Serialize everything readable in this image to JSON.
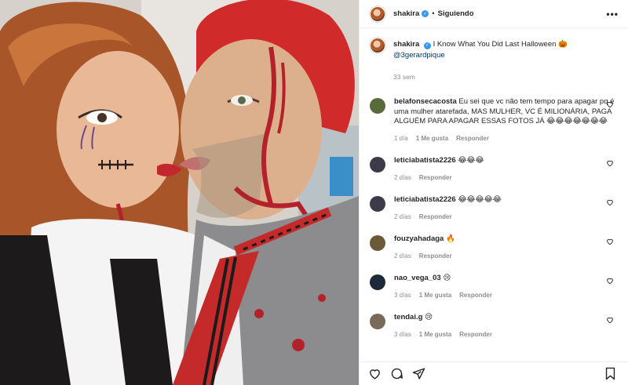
{
  "header": {
    "username": "shakira",
    "separator": "•",
    "follow_state": "Siguiendo",
    "more_icon": "more-options-icon"
  },
  "caption": {
    "username": "shakira",
    "text": "I Know What You Did Last Halloween 🎃",
    "mention": "@3gerardpique",
    "time": "33 sem"
  },
  "comments": [
    {
      "user": "belafonsecacosta",
      "text": "Eu sei que vc não tem tempo para apagar pq é uma mulher atarefada, MAS MULHER, VC É MILIONÁRIA, PAGA ALGUÉM PARA APAGAR ESSAS FOTOS JÁ 😂😂😂😂😂😂😂",
      "time": "1 día",
      "likes": "1 Me gusta",
      "reply": "Responder",
      "avatar_color": "#5a6b3a"
    },
    {
      "user": "leticiabatista2226",
      "text": "😂😂😂",
      "time": "2 días",
      "likes": "",
      "reply": "Responder",
      "avatar_color": "#3d3a4a"
    },
    {
      "user": "leticiabatista2226",
      "text": "😂😂😂😂😂",
      "time": "2 días",
      "likes": "",
      "reply": "Responder",
      "avatar_color": "#3d3a4a"
    },
    {
      "user": "fouzyahadaga",
      "text": "🔥",
      "time": "2 días",
      "likes": "",
      "reply": "Responder",
      "avatar_color": "#6b5a3a"
    },
    {
      "user": "nao_vega_03",
      "text": "😢",
      "time": "3 días",
      "likes": "1 Me gusta",
      "reply": "Responder",
      "avatar_color": "#1e2a3a"
    },
    {
      "user": "tendai.g",
      "text": "😢",
      "time": "3 días",
      "likes": "1 Me gusta",
      "reply": "Responder",
      "avatar_color": "#7a6a5a"
    }
  ],
  "icons": {
    "like": "heart-icon",
    "comment": "comment-icon",
    "share": "share-icon",
    "save": "bookmark-icon"
  }
}
